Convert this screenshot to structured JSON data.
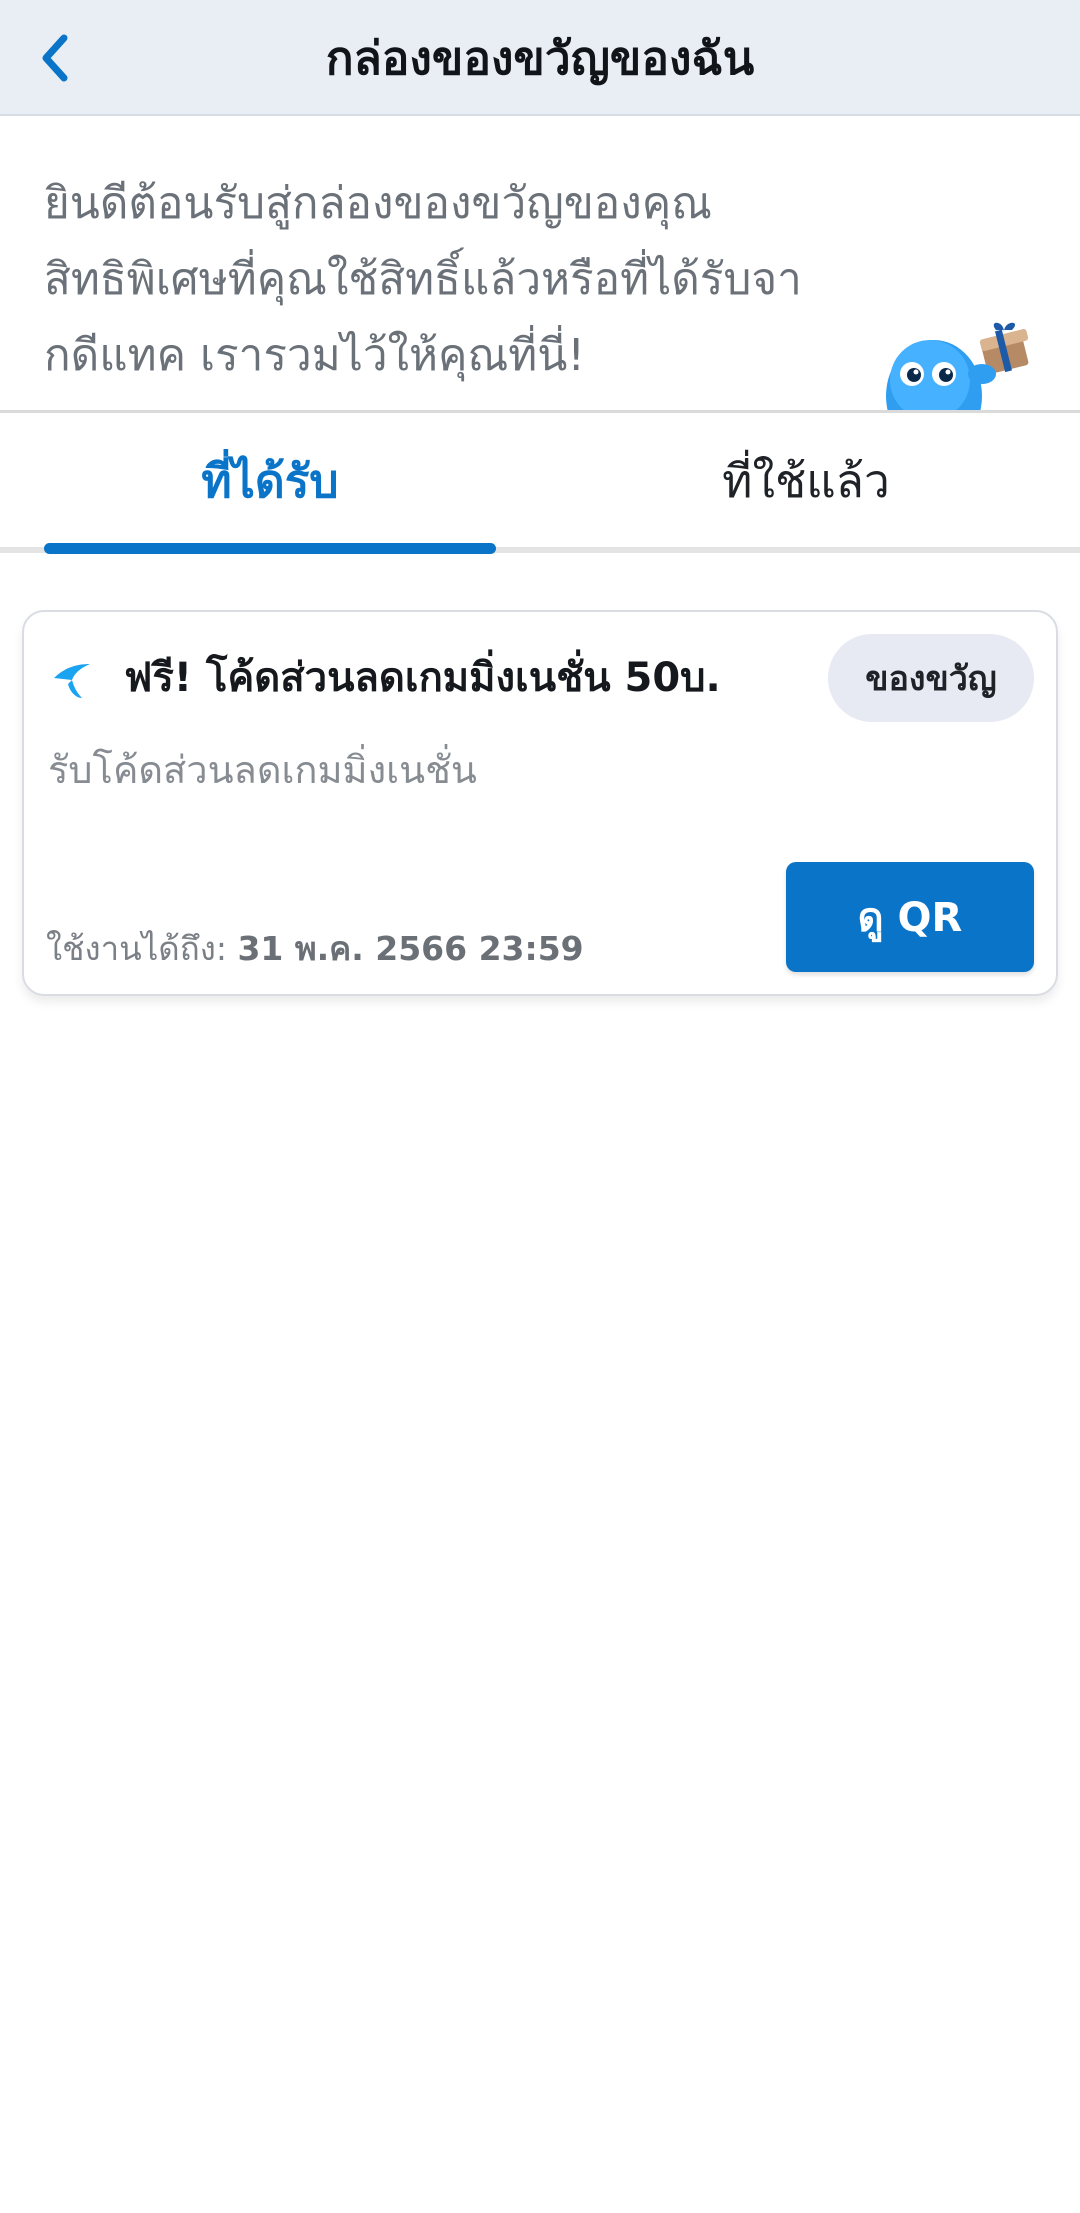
{
  "header": {
    "title": "กล่องของขวัญของฉัน",
    "back_icon": "chevron-left-icon"
  },
  "intro": {
    "text_lines": [
      "ยินดีต้อนรับสู่กล่องของขวัญของคุณ",
      "สิทธิพิเศษที่คุณใช้สิทธิ์แล้วหรือที่ได้รับจา",
      "กดีแทค เรารวมไว้ให้คุณที่นี่!"
    ],
    "mascot_icon": "mascot-with-gift-icon"
  },
  "tabs": [
    {
      "label": "ที่ได้รับ",
      "active": true
    },
    {
      "label": "ที่ใช้แล้ว",
      "active": false
    }
  ],
  "gift_card": {
    "logo_icon": "dtac-logo-icon",
    "title": "ฟรี! โค้ดส่วนลดเกมมิ่งเนชั่น 50บ.",
    "badge": "ของขวัญ",
    "description": "รับโค้ดส่วนลดเกมมิ่งเนชั่น",
    "expiry_label": "ใช้งานได้ถึง:",
    "expiry_value": "31 พ.ค. 2566 23:59",
    "qr_button_label": "ดู QR"
  },
  "colors": {
    "accent": "#0a74c9",
    "header_bg": "#e8eef4",
    "badge_bg": "#e7e9f3",
    "muted_text": "#6b7178"
  }
}
